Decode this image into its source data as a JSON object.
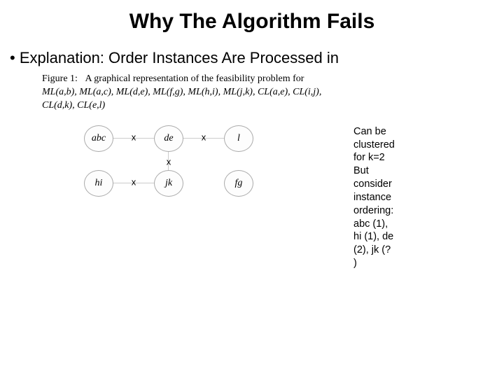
{
  "title": "Why The Algorithm Fails",
  "bullet_prefix": "• ",
  "bullet_text": "Explanation: Order Instances Are Processed in",
  "figure": {
    "caption_lead": "Figure 1:",
    "caption_body": "A graphical representation of the feasibility problem for",
    "constraints": "ML(a,b), ML(a,c), ML(d,e), ML(f,g), ML(h,i), ML(j,k), CL(a,e), CL(i,j), CL(d,k), CL(e,l)",
    "nodes": {
      "abc": "abc",
      "de": "de",
      "l": "l",
      "hi": "hi",
      "jk": "jk",
      "fg": "fg"
    },
    "x": "x"
  },
  "note": {
    "line1": "Can be clustered for k=2",
    "line2": "But consider instance ordering:",
    "line3": "abc (1), hi (1), de (2), jk (? )"
  }
}
